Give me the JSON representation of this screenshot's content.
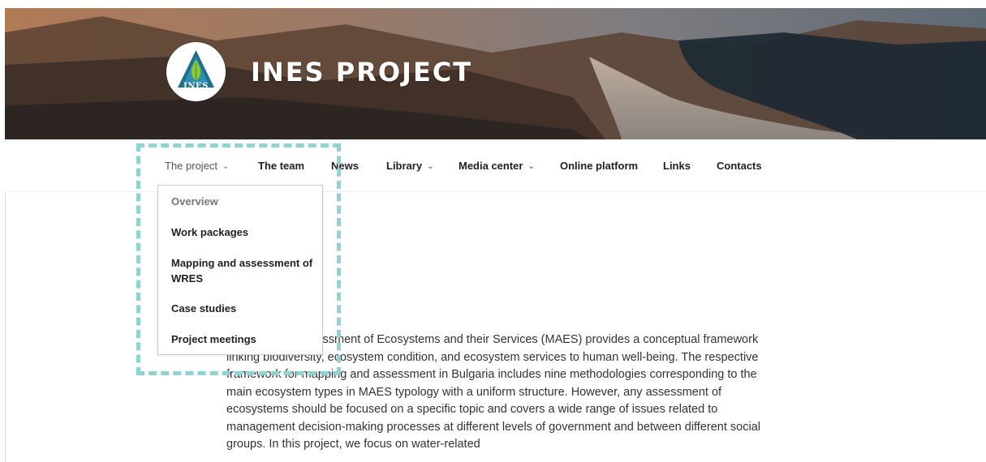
{
  "site": {
    "title": "INES PROJECT",
    "logo_text": "INES"
  },
  "nav": {
    "items": [
      {
        "label": "The project",
        "has_dropdown": true
      },
      {
        "label": "The team",
        "has_dropdown": false
      },
      {
        "label": "News",
        "has_dropdown": false
      },
      {
        "label": "Library",
        "has_dropdown": true
      },
      {
        "label": "Media center",
        "has_dropdown": true
      },
      {
        "label": "Online platform",
        "has_dropdown": false
      },
      {
        "label": "Links",
        "has_dropdown": false
      },
      {
        "label": "Contacts",
        "has_dropdown": false
      }
    ],
    "chevron": "chevron-down-icon"
  },
  "dropdown": {
    "items": [
      "Overview",
      "Work packages",
      "Mapping and assessment of WRES",
      "Case studies",
      "Project meetings"
    ]
  },
  "content": {
    "paragraph": "Mapping and assessment of Ecosystems and their Services (MAES) provides a conceptual framework linking biodiversity, ecosystem condition, and ecosystem services to human well-being. The respective framework for mapping and assessment in Bulgaria includes nine methodologies corresponding to the main ecosystem types in MAES typology with a uniform structure. However, any assessment of ecosystems should be focused on a specific topic and covers a wide range of issues related to management decision-making processes at different levels of government and between different social groups. In this project, we focus on water-related"
  },
  "colors": {
    "highlight": "#8fd3d3",
    "text": "#333333",
    "nav_text": "#222222"
  }
}
